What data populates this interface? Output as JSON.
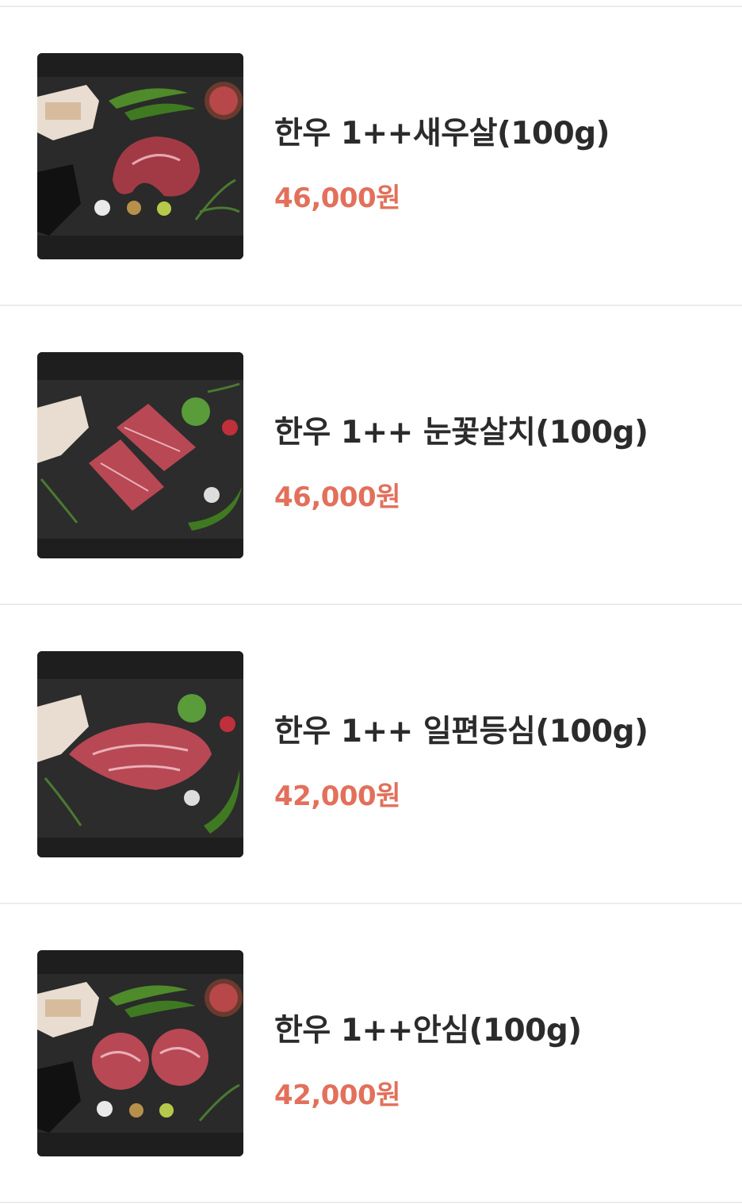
{
  "products": [
    {
      "name": "한우 1++새우살(100g)",
      "price": "46,000원",
      "image": "hanwoo-saeusal-photo"
    },
    {
      "name": "한우 1++ 눈꽃살치(100g)",
      "price": "46,000원",
      "image": "hanwoo-nunkkot-salchi-photo"
    },
    {
      "name": "한우 1++ 일편등심(100g)",
      "price": "42,000원",
      "image": "hanwoo-ilpyeon-deungsim-photo"
    },
    {
      "name": "한우 1++안심(100g)",
      "price": "42,000원",
      "image": "hanwoo-ansim-photo"
    }
  ],
  "colors": {
    "price": "#e2705b",
    "name": "#2b2b2b",
    "divider": "#ececec",
    "background": "#ffffff"
  }
}
